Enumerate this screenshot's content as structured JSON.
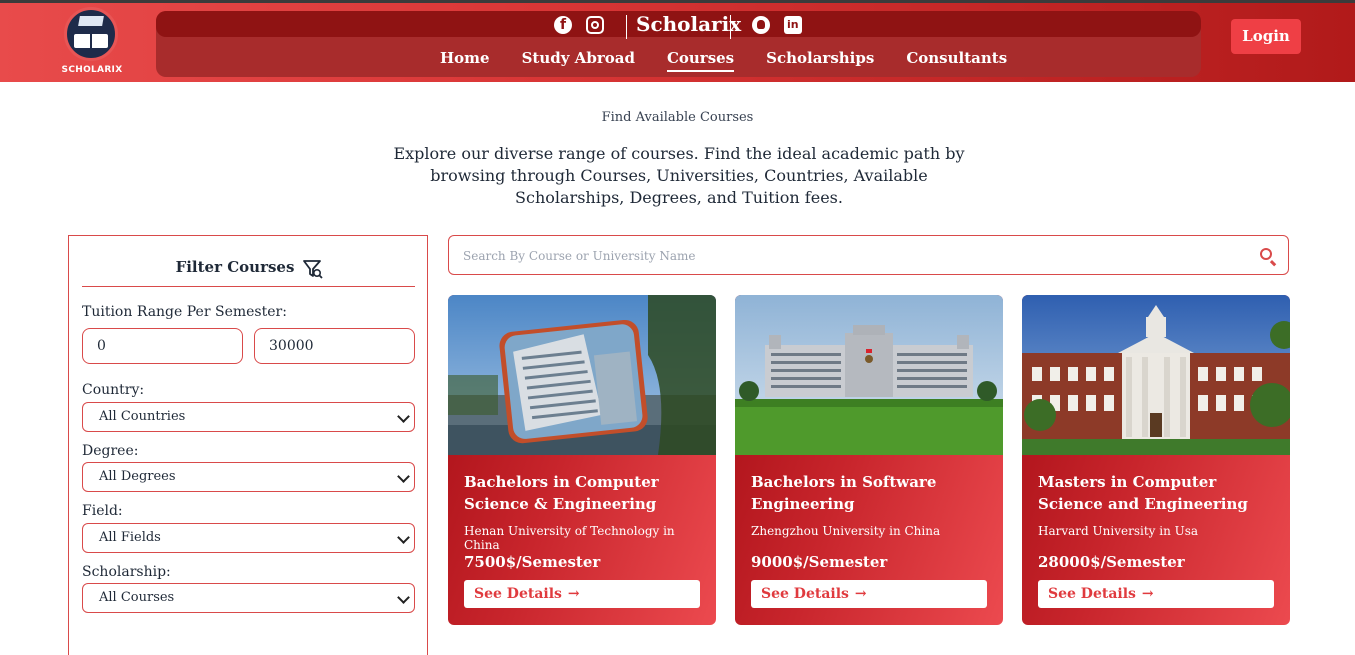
{
  "header": {
    "logo_text": "SCHOLARIX",
    "brand": "Scholarix",
    "nav": [
      {
        "label": "Home",
        "active": false
      },
      {
        "label": "Study Abroad",
        "active": false
      },
      {
        "label": "Courses",
        "active": true
      },
      {
        "label": "Scholarships",
        "active": false
      },
      {
        "label": "Consultants",
        "active": false
      }
    ],
    "login_label": "Login",
    "social_icons": [
      "facebook-icon",
      "instagram-icon",
      "github-icon",
      "linkedin-icon"
    ]
  },
  "intro": {
    "eyebrow": "Find Available Courses",
    "description": "Explore our diverse range of courses. Find the ideal academic path by browsing through Courses, Universities, Countries, Available Scholarships, Degrees, and Tuition fees."
  },
  "filter": {
    "title": "Filter Courses",
    "tuition_label": "Tuition Range Per Semester:",
    "tuition_min": "0",
    "tuition_max": "30000",
    "country_label": "Country:",
    "country_value": "All Countries",
    "degree_label": "Degree:",
    "degree_value": "All Degrees",
    "field_label": "Field:",
    "field_value": "All Fields",
    "scholarship_label": "Scholarship:",
    "scholarship_value": "All Courses"
  },
  "search": {
    "placeholder": "Search By Course or University Name"
  },
  "courses": [
    {
      "title": "Bachelors in Computer Science & Engineering",
      "university": "Henan University of Technology in China",
      "price": "7500$/Semester",
      "cta": "See Details"
    },
    {
      "title": "Bachelors in Software Engineering",
      "university": "Zhengzhou University in China",
      "price": "9000$/Semester",
      "cta": "See Details"
    },
    {
      "title": "Masters in Computer Science and Engineering",
      "university": "Harvard University in Usa",
      "price": "28000$/Semester",
      "cta": "See Details"
    }
  ],
  "colors": {
    "primary": "#d93636",
    "primary_dark": "#8f1313",
    "accent": "#ef3f45",
    "border": "#d94a4a"
  }
}
